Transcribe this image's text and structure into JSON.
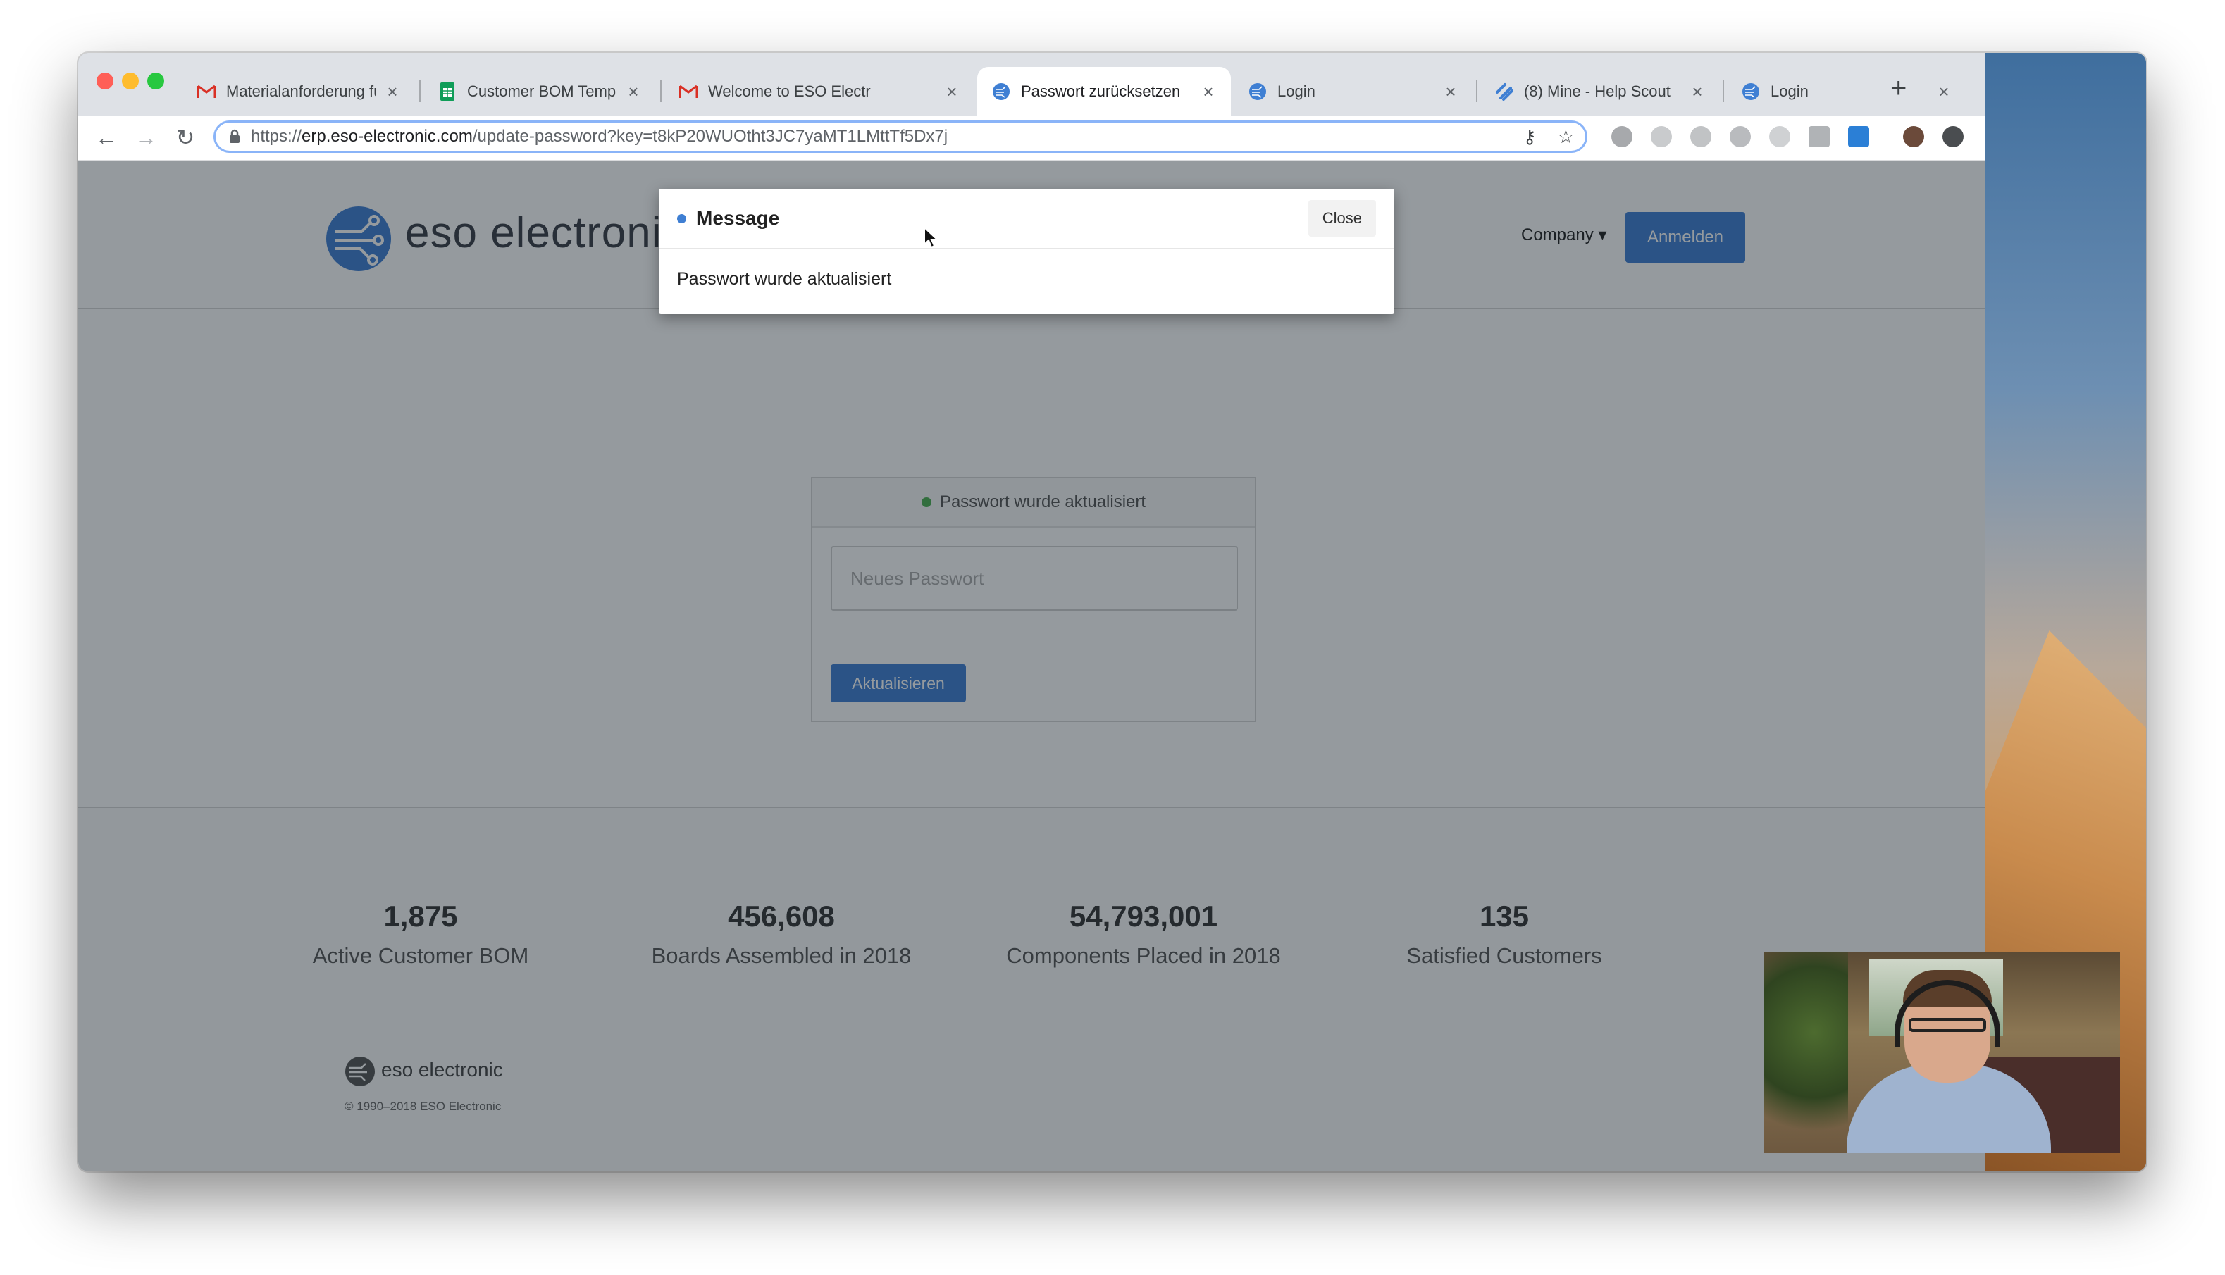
{
  "browser": {
    "tabs": [
      {
        "title": "Materialanforderung für",
        "favicon": "gmail-icon",
        "active": false
      },
      {
        "title": "Customer BOM Templa",
        "favicon": "sheets-icon",
        "active": false
      },
      {
        "title": "Welcome to ESO Electr",
        "favicon": "gmail-icon",
        "active": false
      },
      {
        "title": "Passwort zurücksetzen",
        "favicon": "eso-icon",
        "active": true
      },
      {
        "title": "Login",
        "favicon": "eso-icon",
        "active": false
      },
      {
        "title": "(8) Mine - Help Scout",
        "favicon": "helpscout-icon",
        "active": false
      },
      {
        "title": "Login",
        "favicon": "eso-icon",
        "active": false
      }
    ],
    "url_prefix": "https://",
    "url_domain": "erp.eso-electronic.com",
    "url_path": "/update-password?key=t8kP20WUOtht3JC7yaMT1LMttTf5Dx7j"
  },
  "header": {
    "logo_text": "eso electronic",
    "company_menu": "Company",
    "login_button": "Anmelden"
  },
  "reset_card": {
    "status": "Passwort wurde aktualisiert",
    "password_placeholder": "Neues Passwort",
    "submit": "Aktualisieren"
  },
  "stats": [
    {
      "value": "1,875",
      "label": "Active Customer BOM"
    },
    {
      "value": "456,608",
      "label": "Boards Assembled in 2018"
    },
    {
      "value": "54,793,001",
      "label": "Components Placed in 2018"
    },
    {
      "value": "135",
      "label": "Satisfied Customers"
    }
  ],
  "footer": {
    "logo_text": "eso electronic",
    "copyright": "© 1990–2018 ESO Electronic"
  },
  "modal": {
    "title": "Message",
    "close": "Close",
    "body": "Passwort wurde aktualisiert"
  },
  "colors": {
    "primary": "#3f7fd3",
    "success": "#4caf50"
  }
}
